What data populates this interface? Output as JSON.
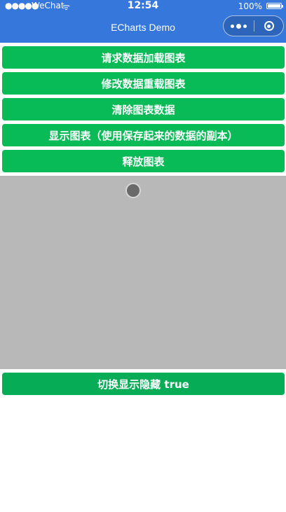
{
  "status_bar": {
    "signal": "●●●●●",
    "carrier": "WeChat",
    "wifi": "ᯤ",
    "time": "12:54",
    "battery_percent": "100%"
  },
  "nav": {
    "title": "ECharts Demo",
    "color": "#3677dc"
  },
  "buttons": {
    "load": "请求数据加载图表",
    "modify": "修改数据重载图表",
    "clear": "清除图表数据",
    "show_copy": "显示图表（使用保存起来的数据的副本）",
    "release": "释放图表",
    "toggle": "切换显示隐藏 true",
    "color": "#09bb57"
  },
  "chart": {
    "background": "#b8b8b8"
  }
}
